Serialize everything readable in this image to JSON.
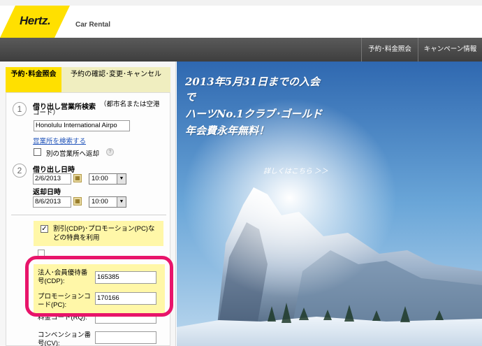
{
  "brand": {
    "logo": "Hertz.",
    "subtitle": "Car Rental"
  },
  "nav": {
    "items": [
      "予約･料金照会",
      "キャンペーン情報"
    ]
  },
  "tabs": {
    "active_label": "予約･料金照会",
    "inactive_label": "予約の確認･変更･キャンセル"
  },
  "step1": {
    "number": "1",
    "title": "借り出し営業所検索",
    "hint": "（都市名または空港コード）",
    "location_value": "Honolulu International Airpo",
    "search_link": "営業所を検索する",
    "return_other_label": "別の営業所へ返却"
  },
  "step2": {
    "number": "2",
    "pickup_label": "借り出し日時",
    "pickup_date": "2/6/2013",
    "pickup_time": "10:00",
    "return_label": "返却日時",
    "return_date": "8/6/2013",
    "return_time": "10:00"
  },
  "discount": {
    "checkbox_label": "割引(CDP)･プロモーション(PC)などの特典を利用",
    "checked": true,
    "cdp_label": "法人･会員優待番号(CDP):",
    "cdp_value": "165385",
    "pc_label": "プロモーションコード(PC):",
    "pc_value": "170166",
    "rq_label": "料金コード(RQ):",
    "cv_label": "コンベンション番号(CV):"
  },
  "hero": {
    "line1": "2013年5月31日までの入会",
    "line2": "で",
    "line3": "ハーツNo.1クラブ･ゴールド",
    "line4": "年会費永年無料！",
    "link": "詳しくはこちら ＞＞"
  },
  "colors": {
    "brand_yellow": "#ffe000",
    "nav_dark": "#4a4a4a",
    "highlight": "#e8146a",
    "promo_bg": "#fff7a8"
  }
}
